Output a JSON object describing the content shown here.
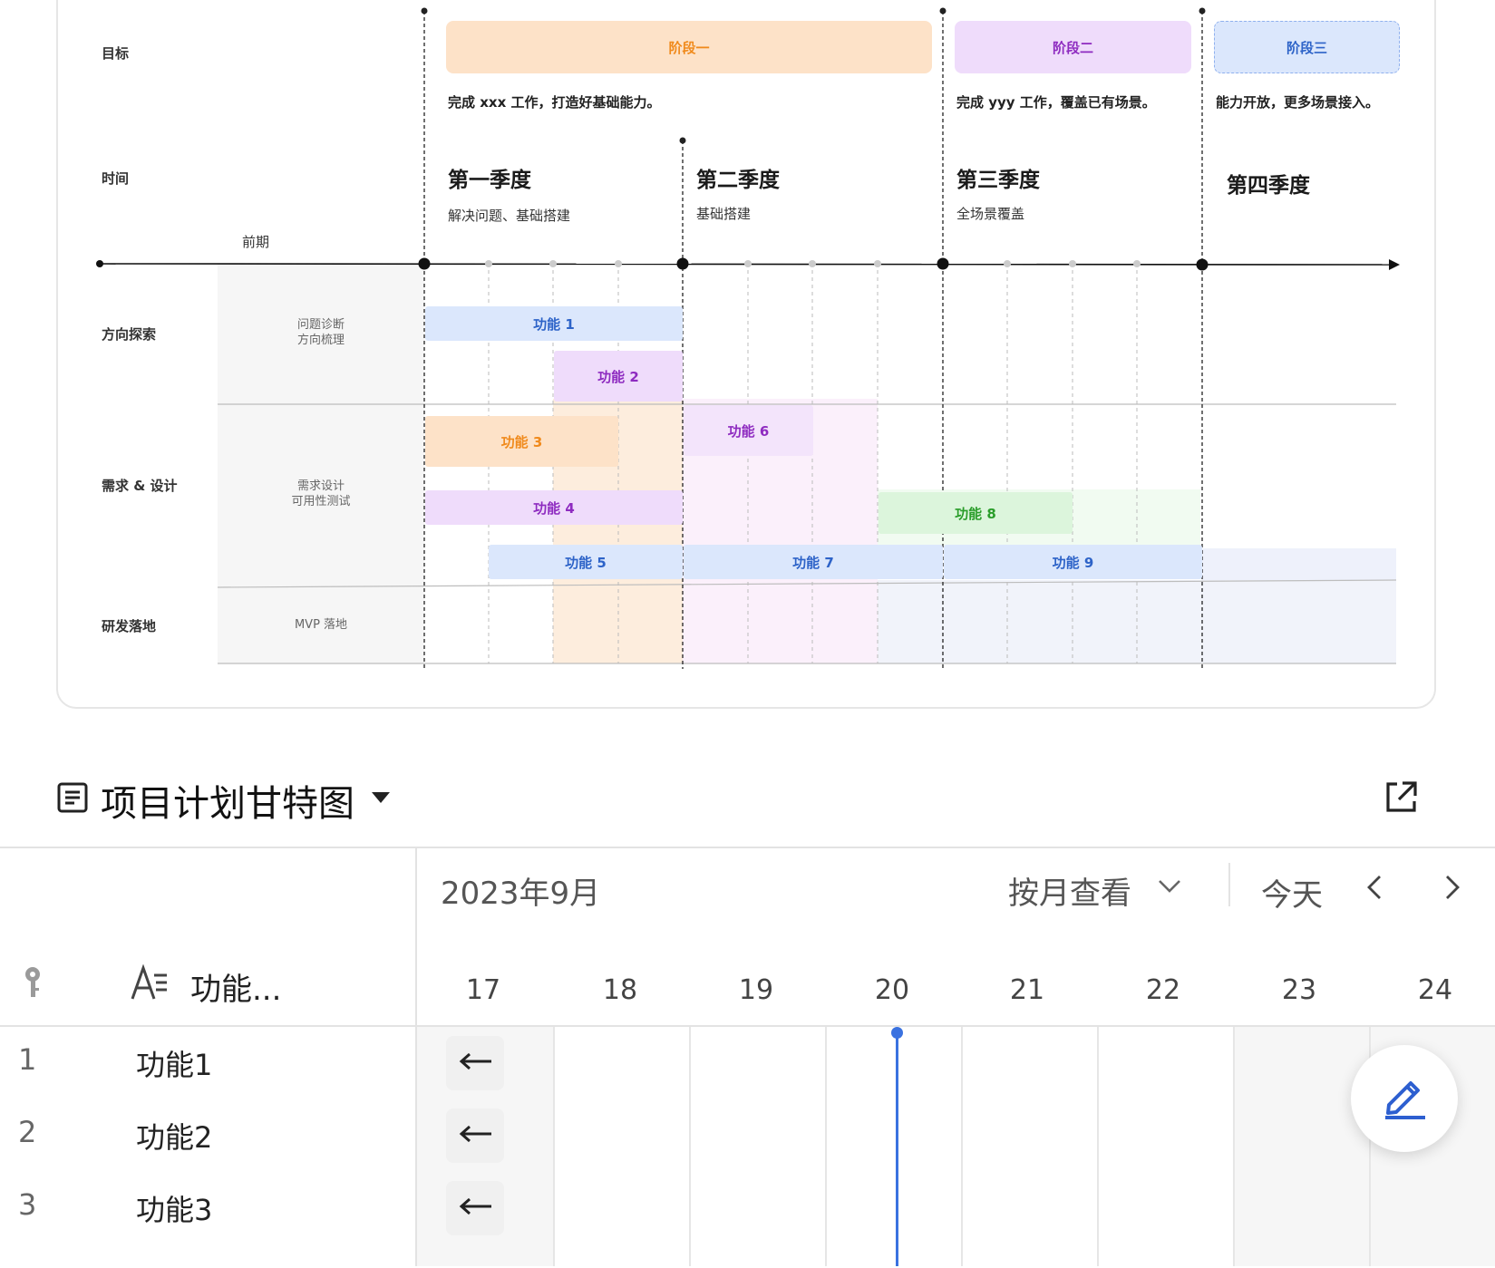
{
  "roadmap": {
    "row_labels": {
      "goal": "目标",
      "time": "时间",
      "explore": "方向探索",
      "design": "需求 & 设计",
      "dev": "研发落地"
    },
    "pre_label": "前期",
    "sub_labels": {
      "explore_1": "问题诊断",
      "explore_2": "方向梳理",
      "design_1": "需求设计",
      "design_2": "可用性测试",
      "dev": "MVP 落地"
    },
    "phases": {
      "p1": "阶段一",
      "p2": "阶段二",
      "p3": "阶段三"
    },
    "goals": {
      "g1": "完成 xxx 工作，打造好基础能力。",
      "g2": "完成 yyy 工作，覆盖已有场景。",
      "g3": "能力开放，更多场景接入。"
    },
    "quarters": {
      "q1_title": "第一季度",
      "q1_sub": "解决问题、基础搭建",
      "q2_title": "第二季度",
      "q2_sub": "基础搭建",
      "q3_title": "第三季度",
      "q3_sub": "全场景覆盖",
      "q4_title": "第四季度"
    },
    "features": {
      "f1": "功能 1",
      "f2": "功能 2",
      "f3": "功能 3",
      "f4": "功能 4",
      "f5": "功能 5",
      "f6": "功能 6",
      "f7": "功能 7",
      "f8": "功能 8",
      "f9": "功能 9"
    },
    "colors": {
      "orange_bg": "#fde2c8",
      "orange_text": "#f08a1c",
      "purple_bg": "#efdcfb",
      "purple_text": "#8e2bc0",
      "blue_bg": "#dbe7fc",
      "blue_text": "#2d63c8",
      "green_bg": "#dcf5dc",
      "green_text": "#2a9d2a"
    }
  },
  "view": {
    "title": "项目计划甘特图",
    "icon": "list-doc-icon",
    "dropdown_icon": "caret-down-icon",
    "open_external_icon": "open-external-icon"
  },
  "gantt": {
    "month": "2023年9月",
    "view_mode": "按月查看",
    "today": "今天",
    "field_header": "功能...",
    "days": [
      "17",
      "18",
      "19",
      "20",
      "21",
      "22",
      "23",
      "24"
    ],
    "rows": [
      {
        "index": "1",
        "name": "功能1"
      },
      {
        "index": "2",
        "name": "功能2"
      },
      {
        "index": "3",
        "name": "功能3"
      }
    ],
    "today_line_color": "#3a72e0"
  }
}
